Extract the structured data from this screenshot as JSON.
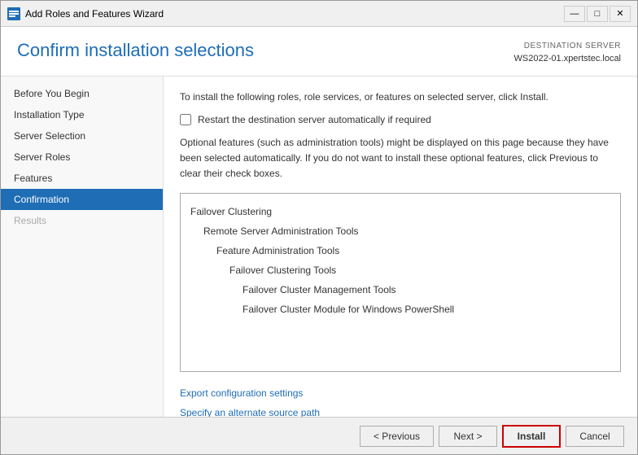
{
  "window": {
    "title": "Add Roles and Features Wizard",
    "controls": {
      "minimize": "—",
      "restore": "□",
      "close": "✕"
    }
  },
  "header": {
    "page_title": "Confirm installation selections",
    "destination_label": "DESTINATION SERVER",
    "destination_server": "WS2022-01.xpertstec.local"
  },
  "sidebar": {
    "items": [
      {
        "id": "before-you-begin",
        "label": "Before You Begin",
        "state": "normal"
      },
      {
        "id": "installation-type",
        "label": "Installation Type",
        "state": "normal"
      },
      {
        "id": "server-selection",
        "label": "Server Selection",
        "state": "normal"
      },
      {
        "id": "server-roles",
        "label": "Server Roles",
        "state": "normal"
      },
      {
        "id": "features",
        "label": "Features",
        "state": "normal"
      },
      {
        "id": "confirmation",
        "label": "Confirmation",
        "state": "active"
      },
      {
        "id": "results",
        "label": "Results",
        "state": "disabled"
      }
    ]
  },
  "main": {
    "instructions": "To install the following roles, role services, or features on selected server, click Install.",
    "checkbox_label": "Restart the destination server automatically if required",
    "optional_notice": "Optional features (such as administration tools) might be displayed on this page because they have been selected automatically. If you do not want to install these optional features, click Previous to clear their check boxes.",
    "features_list": [
      {
        "level": 0,
        "text": "Failover Clustering"
      },
      {
        "level": 1,
        "text": "Remote Server Administration Tools"
      },
      {
        "level": 2,
        "text": "Feature Administration Tools"
      },
      {
        "level": 3,
        "text": "Failover Clustering Tools"
      },
      {
        "level": 4,
        "text": "Failover Cluster Management Tools"
      },
      {
        "level": 4,
        "text": "Failover Cluster Module for Windows PowerShell"
      }
    ],
    "links": [
      "Export configuration settings",
      "Specify an alternate source path"
    ]
  },
  "footer": {
    "previous_label": "< Previous",
    "next_label": "Next >",
    "install_label": "Install",
    "cancel_label": "Cancel"
  }
}
